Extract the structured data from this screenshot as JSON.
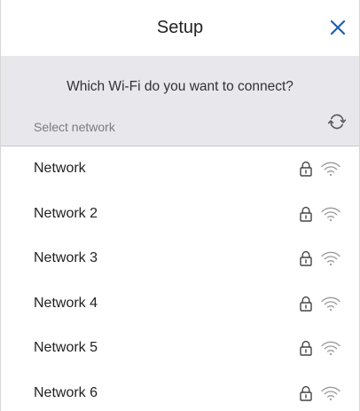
{
  "header": {
    "title": "Setup",
    "close_icon": "close-icon",
    "accent_color": "#1f5fb0"
  },
  "prompt": {
    "question": "Which Wi-Fi do you want to connect?",
    "select_label": "Select network",
    "refresh_icon": "refresh-icon"
  },
  "networks": [
    {
      "name": "Network",
      "secured": true,
      "signal_icon": "wifi-icon"
    },
    {
      "name": "Network 2",
      "secured": true,
      "signal_icon": "wifi-icon"
    },
    {
      "name": "Network 3",
      "secured": true,
      "signal_icon": "wifi-icon"
    },
    {
      "name": "Network 4",
      "secured": true,
      "signal_icon": "wifi-icon"
    },
    {
      "name": "Network 5",
      "secured": true,
      "signal_icon": "wifi-icon"
    },
    {
      "name": "Network 6",
      "secured": true,
      "signal_icon": "wifi-icon"
    }
  ]
}
